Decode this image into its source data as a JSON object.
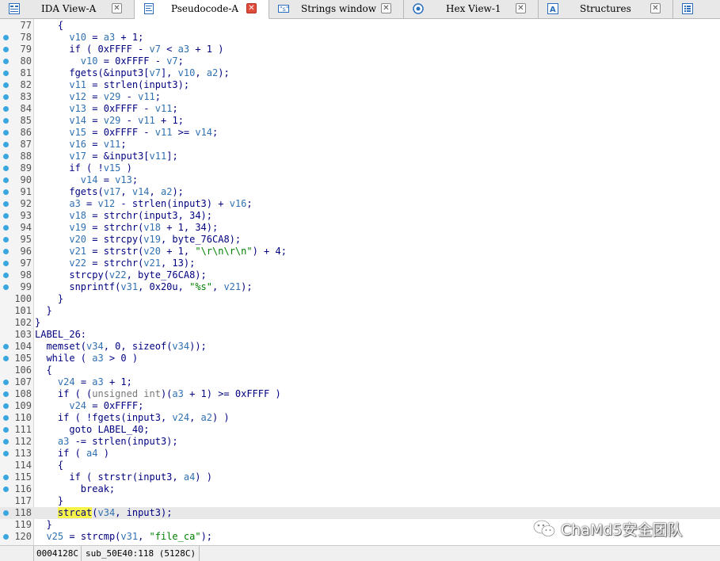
{
  "tabs": [
    {
      "label": "IDA View-A",
      "icon": "ida-view-icon",
      "active": false
    },
    {
      "label": "Pseudocode-A",
      "icon": "pseudocode-icon",
      "active": true
    },
    {
      "label": "Strings window",
      "icon": "strings-icon",
      "active": false
    },
    {
      "label": "Hex View-1",
      "icon": "hex-icon",
      "active": false
    },
    {
      "label": "Structures",
      "icon": "structures-icon",
      "active": false
    },
    {
      "label": "",
      "icon": "enums-icon",
      "active": false
    }
  ],
  "close_glyph": "✕",
  "code_lines": [
    {
      "n": "77",
      "dot": false,
      "text": "    {"
    },
    {
      "n": "78",
      "dot": true,
      "text": "      v10 = a3 + 1;"
    },
    {
      "n": "79",
      "dot": true,
      "text": "      if ( 0xFFFF - v7 < a3 + 1 )"
    },
    {
      "n": "80",
      "dot": true,
      "text": "        v10 = 0xFFFF - v7;"
    },
    {
      "n": "81",
      "dot": true,
      "text": "      fgets(&input3[v7], v10, a2);"
    },
    {
      "n": "82",
      "dot": true,
      "text": "      v11 = strlen(input3);"
    },
    {
      "n": "83",
      "dot": true,
      "text": "      v12 = v29 - v11;"
    },
    {
      "n": "84",
      "dot": true,
      "text": "      v13 = 0xFFFF - v11;"
    },
    {
      "n": "85",
      "dot": true,
      "text": "      v14 = v29 - v11 + 1;"
    },
    {
      "n": "86",
      "dot": true,
      "text": "      v15 = 0xFFFF - v11 >= v14;"
    },
    {
      "n": "87",
      "dot": true,
      "text": "      v16 = v11;"
    },
    {
      "n": "88",
      "dot": true,
      "text": "      v17 = &input3[v11];"
    },
    {
      "n": "89",
      "dot": true,
      "text": "      if ( !v15 )"
    },
    {
      "n": "90",
      "dot": true,
      "text": "        v14 = v13;"
    },
    {
      "n": "91",
      "dot": true,
      "text": "      fgets(v17, v14, a2);"
    },
    {
      "n": "92",
      "dot": true,
      "text": "      a3 = v12 - strlen(input3) + v16;"
    },
    {
      "n": "93",
      "dot": true,
      "text": "      v18 = strchr(input3, 34);"
    },
    {
      "n": "94",
      "dot": true,
      "text": "      v19 = strchr(v18 + 1, 34);"
    },
    {
      "n": "95",
      "dot": true,
      "text": "      v20 = strcpy(v19, byte_76CA8);"
    },
    {
      "n": "96",
      "dot": true,
      "text": "      v21 = strstr(v20 + 1, \"\\r\\n\\r\\n\") + 4;"
    },
    {
      "n": "97",
      "dot": true,
      "text": "      v22 = strchr(v21, 13);"
    },
    {
      "n": "98",
      "dot": true,
      "text": "      strcpy(v22, byte_76CA8);"
    },
    {
      "n": "99",
      "dot": true,
      "text": "      snprintf(v31, 0x20u, \"%s\", v21);"
    },
    {
      "n": "100",
      "dot": false,
      "text": "    }"
    },
    {
      "n": "101",
      "dot": false,
      "text": "  }"
    },
    {
      "n": "102",
      "dot": false,
      "text": "}"
    },
    {
      "n": "103",
      "dot": false,
      "text": "LABEL_26:"
    },
    {
      "n": "104",
      "dot": true,
      "text": "  memset(v34, 0, sizeof(v34));"
    },
    {
      "n": "105",
      "dot": true,
      "text": "  while ( a3 > 0 )"
    },
    {
      "n": "106",
      "dot": false,
      "text": "  {"
    },
    {
      "n": "107",
      "dot": true,
      "text": "    v24 = a3 + 1;"
    },
    {
      "n": "108",
      "dot": true,
      "text": "    if ( (unsigned int)(a3 + 1) >= 0xFFFF )"
    },
    {
      "n": "109",
      "dot": true,
      "text": "      v24 = 0xFFFF;"
    },
    {
      "n": "110",
      "dot": true,
      "text": "    if ( !fgets(input3, v24, a2) )"
    },
    {
      "n": "111",
      "dot": true,
      "text": "      goto LABEL_40;"
    },
    {
      "n": "112",
      "dot": true,
      "text": "    a3 -= strlen(input3);"
    },
    {
      "n": "113",
      "dot": true,
      "text": "    if ( a4 )"
    },
    {
      "n": "114",
      "dot": false,
      "text": "    {"
    },
    {
      "n": "115",
      "dot": true,
      "text": "      if ( strstr(input3, a4) )"
    },
    {
      "n": "116",
      "dot": true,
      "text": "        break;"
    },
    {
      "n": "117",
      "dot": false,
      "text": "    }"
    },
    {
      "n": "118",
      "dot": true,
      "text": "    strcat(v34, input3);",
      "current": true
    },
    {
      "n": "119",
      "dot": false,
      "text": "  }"
    },
    {
      "n": "120",
      "dot": true,
      "text": "  v25 = strcmp(v31, \"file_ca\");"
    }
  ],
  "status": {
    "address": "0004128C",
    "location": "sub_50E40:118 (5128C)"
  },
  "watermark": {
    "text": "ChaMd5安全团队",
    "icon": "wechat-icon"
  }
}
